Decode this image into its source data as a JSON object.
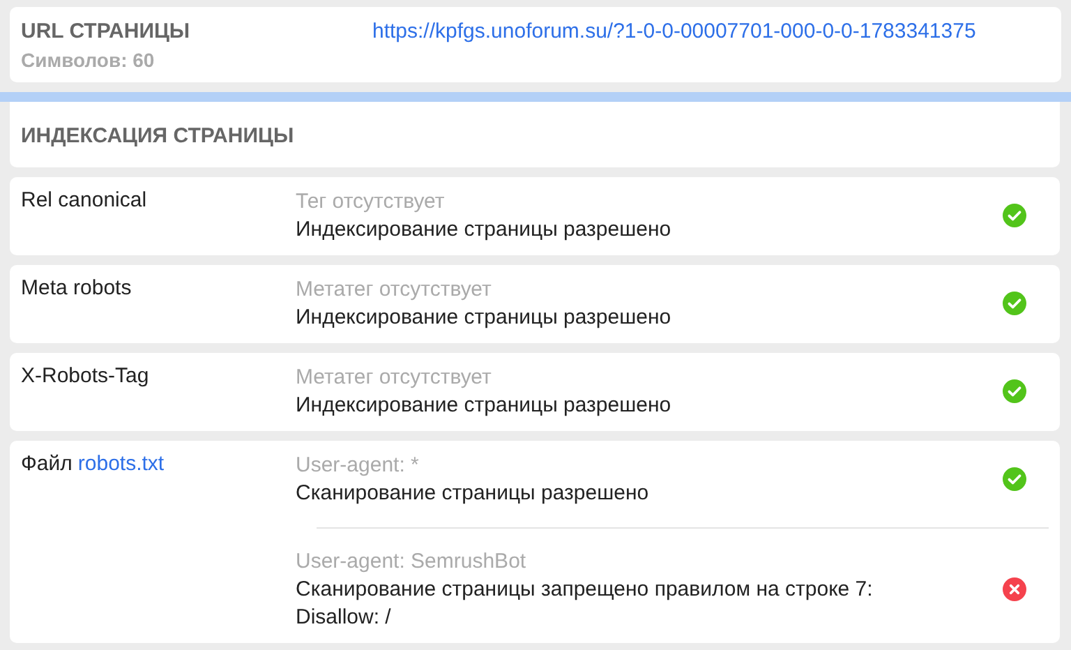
{
  "url_section": {
    "title": "URL СТРАНИЦЫ",
    "count": "Символов: 60",
    "url": "https://kpfgs.unoforum.su/?1-0-0-00007701-000-0-0-1783341375"
  },
  "indexing": {
    "title": "ИНДЕКСАЦИЯ СТРАНИЦЫ",
    "rows": [
      {
        "label": "Rel canonical",
        "entries": [
          {
            "note": "Тег отсутствует",
            "text": "Индексирование страницы разрешено",
            "passed": true
          }
        ]
      },
      {
        "label": "Meta robots",
        "entries": [
          {
            "note": "Метатег отсутствует",
            "text": "Индексирование страницы разрешено",
            "passed": true
          }
        ]
      },
      {
        "label": "X-Robots-Tag",
        "entries": [
          {
            "note": "Метатег отсутствует",
            "text": "Индексирование страницы разрешено",
            "passed": true
          }
        ]
      },
      {
        "label": "Файл",
        "link": "robots.txt",
        "entries": [
          {
            "note": "User-agent: *",
            "text": "Сканирование страницы разрешено",
            "passed": true
          },
          {
            "note": "User-agent: SemrushBot",
            "text": "Сканирование страницы запрещено правилом на строке 7: Disallow: /",
            "passed": false
          }
        ]
      }
    ]
  }
}
